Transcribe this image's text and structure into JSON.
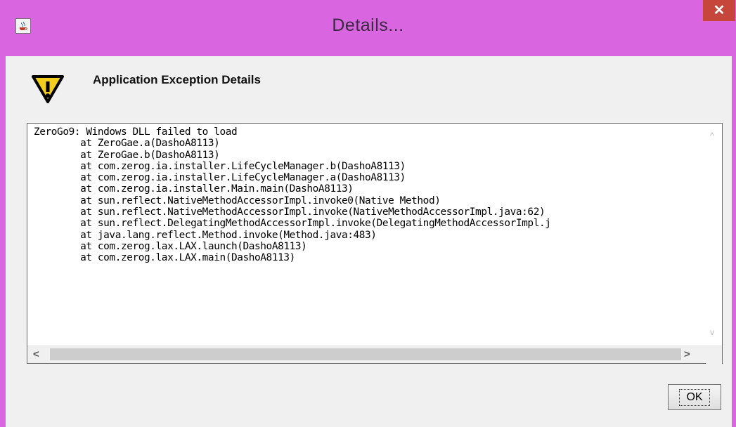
{
  "window": {
    "title": "Details...",
    "close_label": "✕",
    "app_icon": "java-coffee-icon"
  },
  "header": {
    "icon": "warning-triangle-icon",
    "title": "Application Exception Details"
  },
  "details": {
    "text": "ZeroGo9: Windows DLL failed to load\n        at ZeroGae.a(DashoA8113)\n        at ZeroGae.b(DashoA8113)\n        at com.zerog.ia.installer.LifeCycleManager.b(DashoA8113)\n        at com.zerog.ia.installer.LifeCycleManager.a(DashoA8113)\n        at com.zerog.ia.installer.Main.main(DashoA8113)\n        at sun.reflect.NativeMethodAccessorImpl.invoke0(Native Method)\n        at sun.reflect.NativeMethodAccessorImpl.invoke(NativeMethodAccessorImpl.java:62)\n        at sun.reflect.DelegatingMethodAccessorImpl.invoke(DelegatingMethodAccessorImpl.j\n        at java.lang.reflect.Method.invoke(Method.java:483)\n        at com.zerog.lax.LAX.launch(DashoA8113)\n        at com.zerog.lax.LAX.main(DashoA8113)"
  },
  "scrollbars": {
    "up": "^",
    "down": "v",
    "left": "<",
    "right": ">"
  },
  "buttons": {
    "ok_label": "OK"
  },
  "colors": {
    "title_bar": "#d966e0",
    "close_button": "#c7463b",
    "dialog_background": "#f0f0f0"
  }
}
